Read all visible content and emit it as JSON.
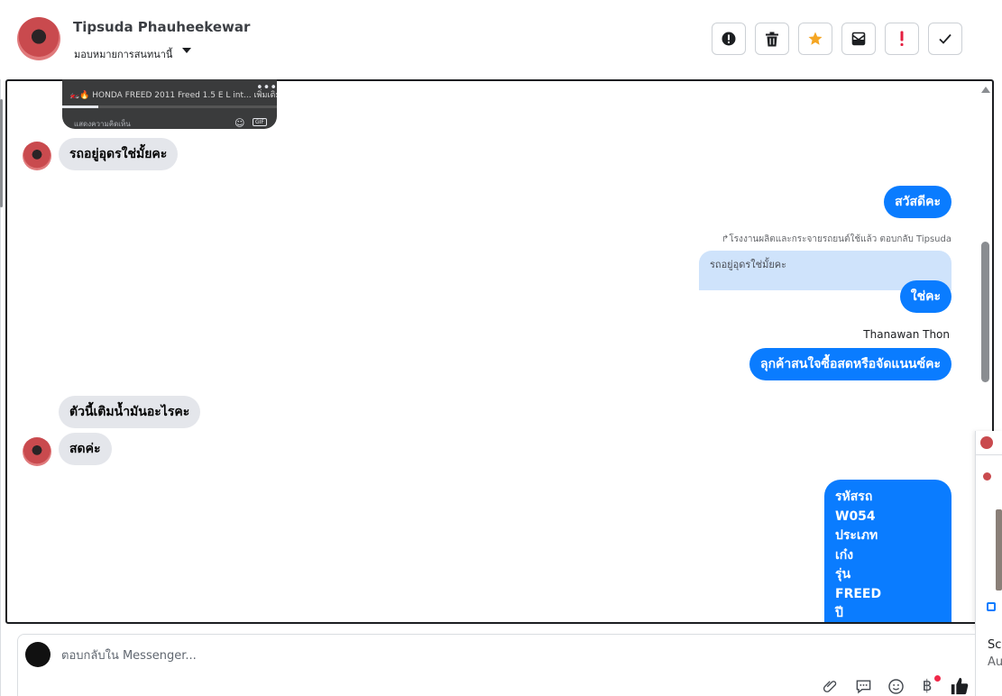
{
  "header": {
    "contact_name": "Tipsuda Phauheekewar",
    "assign_label": "มอบหมายการสนทนานี้",
    "tools": [
      {
        "name": "report-button",
        "icon": "alert-circle-icon"
      },
      {
        "name": "delete-button",
        "icon": "trash-icon"
      },
      {
        "name": "star-button",
        "icon": "star-icon"
      },
      {
        "name": "mark-unread-button",
        "icon": "envelope-icon"
      },
      {
        "name": "follow-up-button",
        "icon": "exclamation-icon"
      },
      {
        "name": "mark-done-button",
        "icon": "check-icon"
      }
    ]
  },
  "thread": {
    "media_card": {
      "title": "🏍️🔥 HONDA FREED 2011 Freed 1.5 E L int... เพิ่มเติม",
      "comment_placeholder": "แสดงความคิดเห็น",
      "dots": "•••",
      "gif": "GIF"
    },
    "messages": {
      "in_1": "รถอยู่อุดรใช่มั้ยคะ",
      "out_1": "สวัสดีคะ",
      "reply_meta": "โรงงานผลิตและกระจายรถยนต์ใช้แล้ว ตอบกลับ Tipsuda",
      "quoted": "รถอยู่อุดรใช่มั้ยคะ",
      "out_2": "ใช่คะ",
      "sender_name": "Thanawan Thon",
      "out_3": "ลุกค้าสนใจซื้อสดหรือจัดแนนซ์คะ",
      "in_2": "ตัวนี้เติมน้ำมันอะไรคะ",
      "in_3": "สดค่ะ",
      "out_4_lines": [
        "รหัสรถ",
        "W054",
        "ประเภท",
        "เก๋ง",
        "รุ่น",
        "FREED",
        "ปี"
      ]
    }
  },
  "composer": {
    "placeholder": "ตอบกลับใน Messenger...",
    "icons": [
      "paperclip-icon",
      "saved-reply-icon",
      "emoji-icon",
      "baht-icon",
      "like-icon"
    ],
    "baht_symbol": "฿"
  },
  "side_panel": {
    "card_title": "Scr",
    "card_subtitle": "Au"
  },
  "colors": {
    "accent": "#0a7cff",
    "star": "#f5a623",
    "alert_red": "#e41e3f"
  }
}
